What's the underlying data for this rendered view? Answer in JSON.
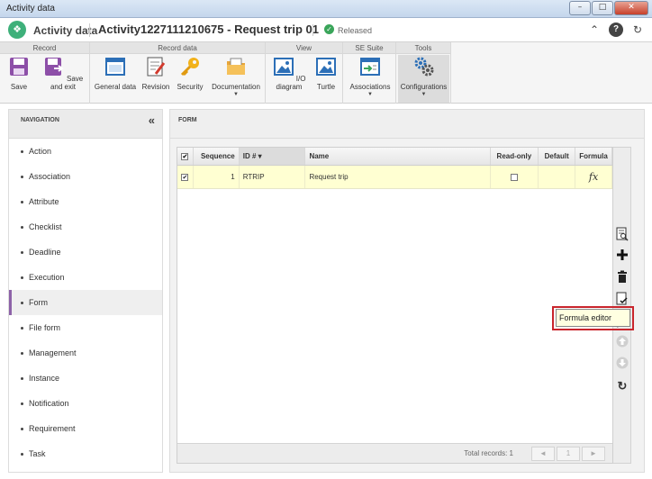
{
  "window": {
    "title": "Activity data",
    "buttons": [
      "–",
      "□",
      "✕"
    ]
  },
  "header": {
    "app_title": "Activity data",
    "record_title": "Activity1227111210675 - Request trip 01",
    "status": "Released",
    "icons": [
      "collapse-up-icon",
      "help-icon",
      "refresh-icon"
    ]
  },
  "ribbon": {
    "groups": [
      {
        "title": "Record",
        "buttons": [
          "Save",
          "Save and exit"
        ]
      },
      {
        "title": "Record data",
        "buttons": [
          "General data",
          "Revision",
          "Security",
          "Documentation"
        ]
      },
      {
        "title": "View",
        "buttons": [
          "I/O diagram",
          "Turtle"
        ]
      },
      {
        "title": "SE Suite",
        "buttons": [
          "Associations"
        ]
      },
      {
        "title": "Tools",
        "buttons": [
          "Configurations"
        ]
      }
    ],
    "accent_save": "#8d4fa8"
  },
  "navigation": {
    "title": "NAVIGATION",
    "collapse_glyph": "«",
    "items": [
      "Action",
      "Association",
      "Attribute",
      "Checklist",
      "Deadline",
      "Execution",
      "Form",
      "File form",
      "Management",
      "Instance",
      "Notification",
      "Requirement",
      "Task"
    ],
    "active": "Form",
    "active_color": "#8d62a8"
  },
  "form": {
    "title": "FORM",
    "columns": [
      "Sequence",
      "ID #",
      "Name",
      "Read-only",
      "Default",
      "Formula"
    ],
    "sort_indicator": "▾",
    "rows": [
      {
        "checked": true,
        "sequence": "1",
        "id": "RTRIP",
        "name": "Request trip",
        "read_only": false,
        "default": "",
        "formula": "fx"
      }
    ],
    "row_color": "#ffffd2",
    "footer": {
      "total": "Total records: 1",
      "page": "1",
      "prev": "◄",
      "next": "►",
      "first_prev": "◄"
    },
    "tooltip": "Formula editor"
  }
}
